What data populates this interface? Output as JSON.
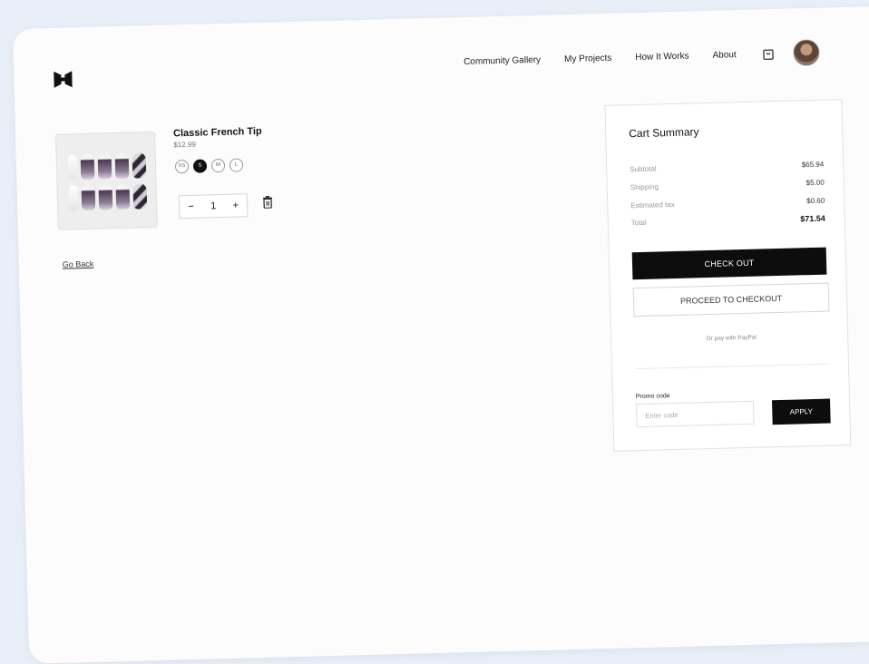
{
  "nav": {
    "links": [
      "Community Gallery",
      "My Projects",
      "How It Works",
      "About"
    ],
    "cart_icon": "shopping-bag-icon",
    "avatar_icon": "user-avatar"
  },
  "product": {
    "name": "Classic French Tip",
    "price": "$12.99",
    "sizes": [
      "XS",
      "S",
      "M",
      "L"
    ],
    "selected_size": "S",
    "quantity": "1",
    "minus": "−",
    "plus": "+"
  },
  "go_back": "Go Back",
  "summary": {
    "title": "Cart Summary",
    "subtotal_label": "Subtotal",
    "subtotal": "$65.94",
    "shipping_label": "Shipping",
    "shipping": "$5.00",
    "tax_label": "Estimated tax",
    "tax": "$0.60",
    "total_label": "Total",
    "total": "$71.54",
    "checkout_label": "CHECK OUT",
    "proceed_label": "PROCEED TO CHECKOUT",
    "paypal_text": "Or pay with PayPal",
    "promo_label": "Promo code",
    "promo_placeholder": "Enter code",
    "apply_label": "APPLY"
  },
  "colors": {
    "background": "#e9eff8",
    "page": "#fcfcfc",
    "primary_button": "#0d0d0d"
  }
}
